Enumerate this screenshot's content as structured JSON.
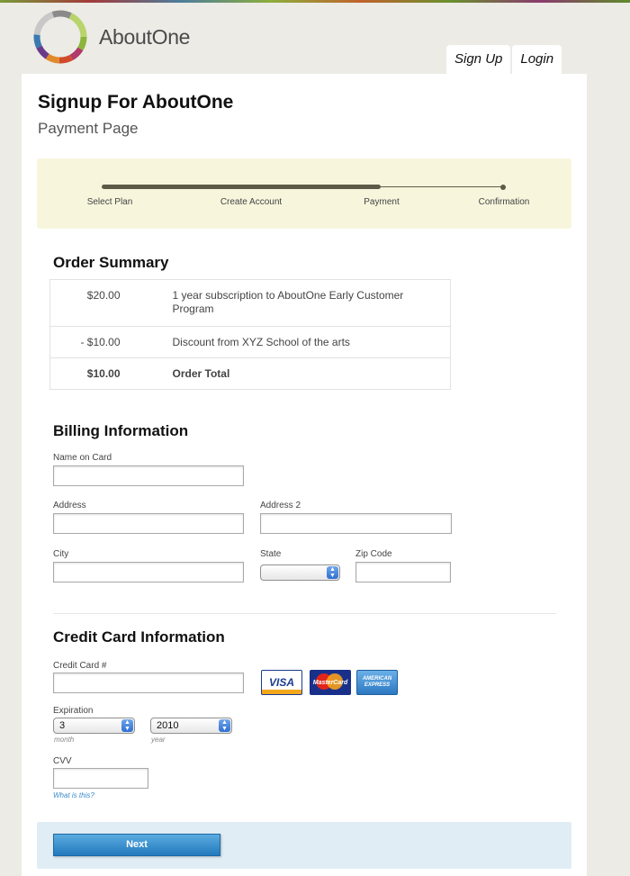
{
  "header": {
    "brand": "AboutOne",
    "tabs": [
      "Sign Up",
      "Login"
    ]
  },
  "page": {
    "title": "Signup For AboutOne",
    "subtitle": "Payment Page"
  },
  "progress": {
    "steps": [
      "Select Plan",
      "Create Account",
      "Payment",
      "Confirmation"
    ],
    "current_step": "Payment"
  },
  "order_summary": {
    "heading": "Order Summary",
    "rows": [
      {
        "amount": "$20.00",
        "description": "1 year subscription to AboutOne Early Customer Program"
      },
      {
        "amount": "- $10.00",
        "description": "Discount from XYZ School of the arts"
      },
      {
        "amount": "$10.00",
        "description": "Order Total"
      }
    ]
  },
  "billing": {
    "heading": "Billing Information",
    "name_label": "Name on Card",
    "address_label": "Address",
    "address2_label": "Address 2",
    "city_label": "City",
    "state_label": "State",
    "zip_label": "Zip Code"
  },
  "credit_card": {
    "heading": "Credit Card Information",
    "number_label": "Credit Card #",
    "card_brands": [
      "VISA",
      "MasterCard",
      "AMERICAN EXPRESS"
    ],
    "expiration_label": "Expiration",
    "month_value": "3",
    "year_value": "2010",
    "month_hint": "month",
    "year_hint": "year",
    "cvv_label": "CVV",
    "cvv_help_link": "What is this?"
  },
  "footer": {
    "next_label": "Next"
  },
  "colors": {
    "progress_bg": "#f7f6dd",
    "footer_bg": "#e1edf5",
    "button_blue": "#2279bd",
    "link_blue": "#3a8ac9"
  }
}
